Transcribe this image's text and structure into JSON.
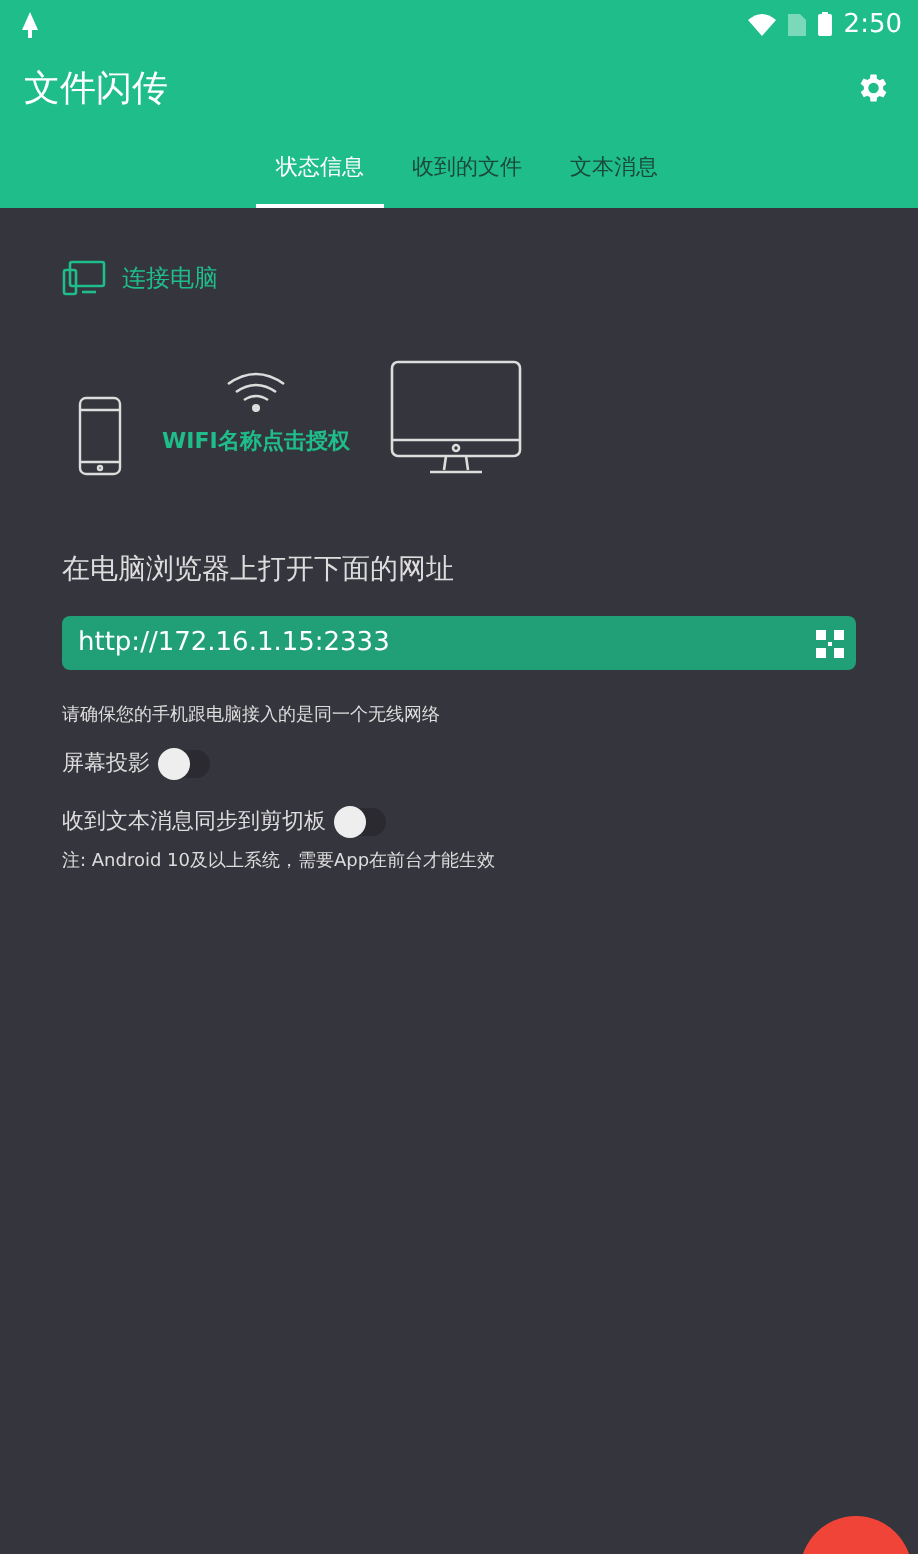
{
  "status_bar": {
    "time": "2:50"
  },
  "app_bar": {
    "title": "文件闪传"
  },
  "tabs": [
    {
      "label": "状态信息",
      "selected": true
    },
    {
      "label": "收到的文件",
      "selected": false
    },
    {
      "label": "文本消息",
      "selected": false
    }
  ],
  "connect": {
    "label": "连接电脑",
    "wifi_label": "WIFI名称点击授权"
  },
  "url_section": {
    "heading": "在电脑浏览器上打开下面的网址",
    "url": "http://172.16.1.15:2333",
    "hint": "请确保您的手机跟电脑接入的是同一个无线网络"
  },
  "switches": [
    {
      "label": "屏幕投影",
      "on": false
    },
    {
      "label": "收到文本消息同步到剪切板",
      "on": false
    }
  ],
  "note": "注: Android 10及以上系统，需要App在前台才能生效"
}
